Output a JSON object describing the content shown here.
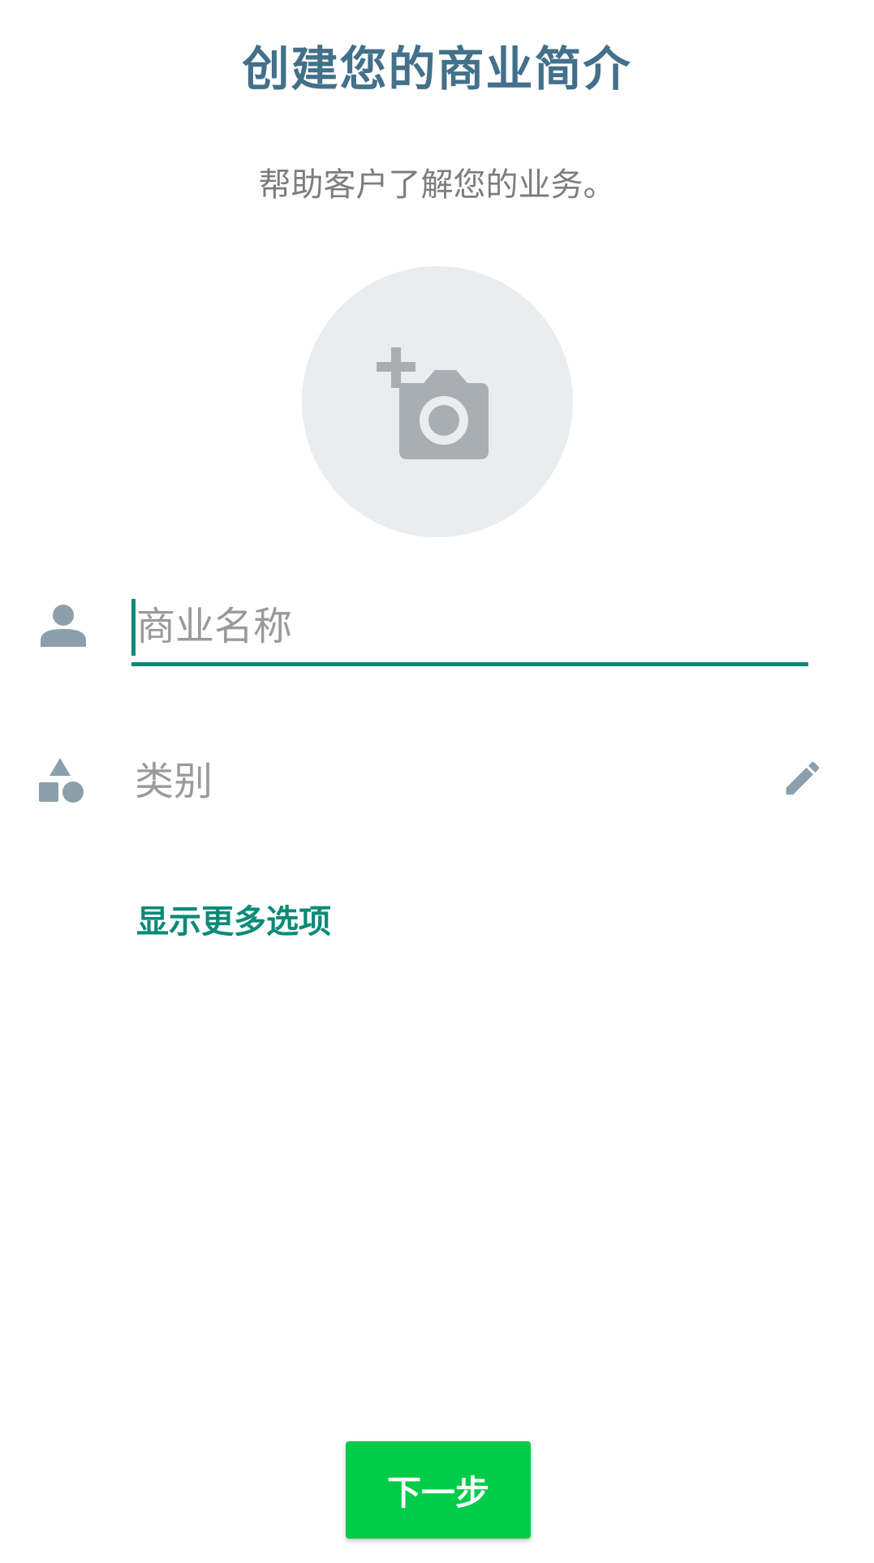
{
  "header": {
    "title": "创建您的商业简介",
    "subtitle": "帮助客户了解您的业务。"
  },
  "profile_photo": {
    "icon": "add-photo-camera-icon"
  },
  "form": {
    "business_name": {
      "icon": "person-icon",
      "placeholder": "商业名称",
      "value": ""
    },
    "category": {
      "icon": "shapes-icon",
      "label": "类别",
      "edit_icon": "pencil-icon"
    },
    "more_options_label": "显示更多选项"
  },
  "footer": {
    "next_label": "下一步"
  },
  "colors": {
    "title": "#43708a",
    "accent": "#0b8a78",
    "button": "#00cc4a",
    "icon": "#8aa0ab",
    "photo_bg": "#ebecee",
    "photo_icon": "#a9aeb3"
  }
}
